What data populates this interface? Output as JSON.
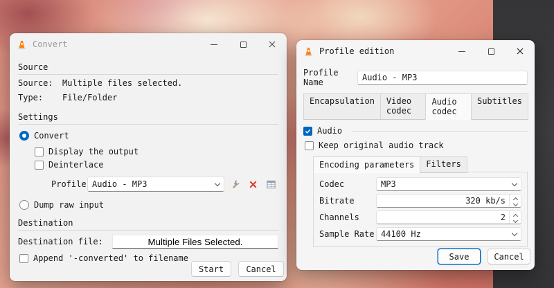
{
  "accent": "#0067c0",
  "convert_window": {
    "title": "Convert",
    "source": {
      "header": "Source",
      "source_label": "Source:",
      "source_value": "Multiple files selected.",
      "type_label": "Type:",
      "type_value": "File/Folder"
    },
    "settings": {
      "header": "Settings",
      "convert_label": "Convert",
      "display_output_label": "Display the output",
      "deinterlace_label": "Deinterlace",
      "profile_label": "Profile",
      "profile_value": "Audio - MP3",
      "dump_raw_label": "Dump raw input"
    },
    "destination": {
      "header": "Destination",
      "file_label": "Destination file:",
      "file_value": "Multiple Files Selected.",
      "append_label": "Append '-converted' to filename"
    },
    "start_label": "Start",
    "cancel_label": "Cancel"
  },
  "profile_window": {
    "title": "Profile edition",
    "profile_name_label": "Profile Name",
    "profile_name_value": "Audio - MP3",
    "tabs": [
      "Encapsulation",
      "Video codec",
      "Audio codec",
      "Subtitles"
    ],
    "audio_label": "Audio",
    "keep_original_label": "Keep original audio track",
    "subtabs": [
      "Encoding parameters",
      "Filters"
    ],
    "codec_label": "Codec",
    "codec_value": "MP3",
    "bitrate_label": "Bitrate",
    "bitrate_value": "320 kb/s",
    "channels_label": "Channels",
    "channels_value": "2",
    "sample_rate_label": "Sample Rate",
    "sample_rate_value": "44100 Hz",
    "save_label": "Save",
    "cancel_label": "Cancel"
  }
}
